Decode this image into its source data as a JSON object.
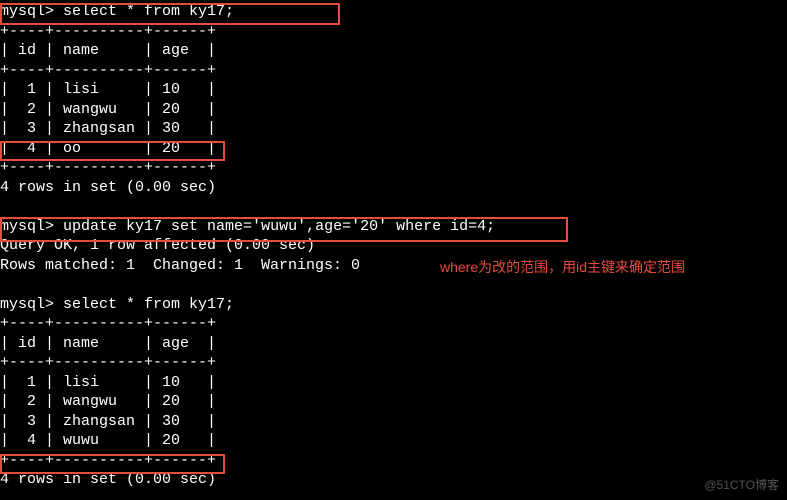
{
  "prompt": "mysql>",
  "queries": {
    "select1": "select * from ky17;",
    "update": "update ky17 set name='wuwu',age='20' where id=4;",
    "select2": "select * from ky17;"
  },
  "table": {
    "border_top": "+----+----------+------+",
    "header": "| id | name     | age  |",
    "rows_before": [
      "|  1 | lisi     | 10   |",
      "|  2 | wangwu   | 20   |",
      "|  3 | zhangsan | 30   |",
      "|  4 | oo       | 20   |"
    ],
    "rows_after": [
      "|  1 | lisi     | 10   |",
      "|  2 | wangwu   | 20   |",
      "|  3 | zhangsan | 30   |",
      "|  4 | wuwu     | 20   |"
    ]
  },
  "results": {
    "rows_in_set": "4 rows in set (0.00 sec)",
    "query_ok": "Query OK, 1 row affected (0.00 sec)",
    "rows_matched": "Rows matched: 1  Changed: 1  Warnings: 0"
  },
  "annotation": "where为改的范围，用id主键来确定范围",
  "watermark": "@51CTO博客",
  "chart_data": {
    "type": "table",
    "title": "ky17",
    "columns": [
      "id",
      "name",
      "age"
    ],
    "before_update": [
      {
        "id": 1,
        "name": "lisi",
        "age": 10
      },
      {
        "id": 2,
        "name": "wangwu",
        "age": 20
      },
      {
        "id": 3,
        "name": "zhangsan",
        "age": 30
      },
      {
        "id": 4,
        "name": "oo",
        "age": 20
      }
    ],
    "after_update": [
      {
        "id": 1,
        "name": "lisi",
        "age": 10
      },
      {
        "id": 2,
        "name": "wangwu",
        "age": 20
      },
      {
        "id": 3,
        "name": "zhangsan",
        "age": 30
      },
      {
        "id": 4,
        "name": "wuwu",
        "age": 20
      }
    ]
  }
}
